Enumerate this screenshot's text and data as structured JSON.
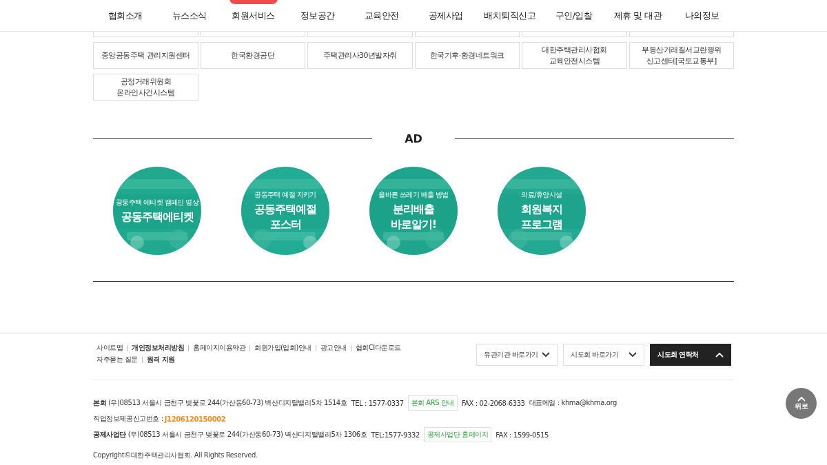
{
  "nav": {
    "items": [
      {
        "label": "협회소개",
        "badge": false
      },
      {
        "label": "뉴스소식",
        "badge": false
      },
      {
        "label": "회원서비스",
        "badge": true
      },
      {
        "label": "정보공간",
        "badge": false
      },
      {
        "label": "교육안전",
        "badge": false
      },
      {
        "label": "공제사업",
        "badge": false
      },
      {
        "label": "배치퇴직신고",
        "badge": false
      },
      {
        "label": "구인/입찰",
        "badge": false
      },
      {
        "label": "제휴 및 대관",
        "badge": false
      },
      {
        "label": "나의정보",
        "badge": false
      }
    ]
  },
  "link_tiles": {
    "items": [
      {
        "lines": [
          "중앙공동주택 관리지원센터"
        ]
      },
      {
        "lines": [
          "한국환경공단"
        ]
      },
      {
        "lines": [
          "주택관리사30년발자취"
        ]
      },
      {
        "lines": [
          "한국기후·환경네트워크"
        ]
      },
      {
        "lines": [
          "대한주택관리사협회",
          "교육안전시스템"
        ]
      },
      {
        "lines": [
          "부동산거래질서교란행위",
          "신고센터[국토교통부]"
        ]
      },
      {
        "lines": [
          "공정거래위원회",
          "온라인사건시스템"
        ]
      }
    ]
  },
  "ad": {
    "heading": "AD",
    "banners": [
      {
        "subtitle": "공동주택 에티켓 캠페인 영상",
        "title_lines": [
          "공동주택에티켓"
        ]
      },
      {
        "subtitle": "공동주택 예절 지키기",
        "title_lines": [
          "공동주택예절",
          "포스터"
        ]
      },
      {
        "subtitle": "올바른 쓰레기 배출 방법",
        "title_lines": [
          "분리배출",
          "바로알기!"
        ]
      },
      {
        "subtitle": "의료/휴양시설",
        "title_lines": [
          "회원복지",
          "프로그램"
        ]
      }
    ]
  },
  "footer": {
    "link_rows": [
      [
        {
          "label": "사이트맵",
          "bold": false
        },
        {
          "label": "개인정보처리방침",
          "bold": true
        },
        {
          "label": "홈페이지이용약관",
          "bold": false
        },
        {
          "label": "회원가입(입회)안내",
          "bold": false
        },
        {
          "label": "광고안내",
          "bold": false
        },
        {
          "label": "협회CI다운로드",
          "bold": false
        }
      ],
      [
        {
          "label": "자주묻는 질문",
          "bold": false
        },
        {
          "label": "원격 지원",
          "bold": true
        }
      ]
    ],
    "selects": [
      {
        "label": "유관기관 바로가기",
        "expanded": false,
        "dark": false
      },
      {
        "label": "시도회 바로가기",
        "expanded": false,
        "dark": false
      },
      {
        "label": "시도회 연락처",
        "expanded": true,
        "dark": true
      }
    ],
    "head_office": {
      "label": "본회",
      "address": "(우)08513 서울시 금천구 벚꽃로 244(가산동60-73) 벽산디지털밸리5차 1514호",
      "tel": "TEL : 1577-0337",
      "button": "본회 ARS 안내",
      "fax": "FAX : 02-2068-6333",
      "email": "대표메일 : khma@khma.org"
    },
    "job_info": {
      "label": "직업정보제공신고번호 :",
      "number": "J1206120150002"
    },
    "mutual_aid": {
      "label": "공제사업단",
      "address": "(우)08513 서울시 금천구 벚꽃로 244(가산동60-73) 벽산디지털밸리5차 1306호",
      "tel": "TEL:1577-9332",
      "button": "공제사업단 홈페이지",
      "fax": "FAX : 1599-0515"
    },
    "copyright": "Copyright©대한주택관리사협회. All Rights Reserved."
  },
  "top_button": {
    "label": "위로"
  }
}
